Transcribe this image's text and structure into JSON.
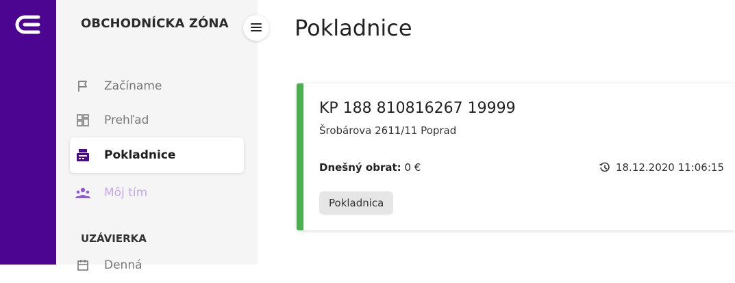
{
  "sidebar": {
    "zone_title": "OBCHODNÍCKA ZÓNA",
    "items": [
      {
        "label": "Začíname",
        "icon": "flag-icon"
      },
      {
        "label": "Prehľad",
        "icon": "dashboard-icon"
      },
      {
        "label": "Pokladnice",
        "icon": "cash-register-icon"
      },
      {
        "label": "Môj tím",
        "icon": "team-icon"
      }
    ],
    "section_heading": "UZÁVIERKA",
    "section_items": [
      {
        "label": "Denná",
        "icon": "calendar-icon"
      }
    ]
  },
  "page": {
    "title": "Pokladnice"
  },
  "register": {
    "code": "KP 188 810816267 19999",
    "address": "Šrobárova 2611/11 Poprad",
    "turnover_label": "Dnešný obrat:",
    "turnover_value": "0 €",
    "timestamp": "18.12.2020 11:06:15",
    "chip": "Pokladnica"
  },
  "colors": {
    "rail": "#4b0590",
    "sidebar": "#f5f5f5",
    "active_accent": "#4b0590",
    "status_green": "#4caf50",
    "muted_item": "#c3a9e6"
  }
}
